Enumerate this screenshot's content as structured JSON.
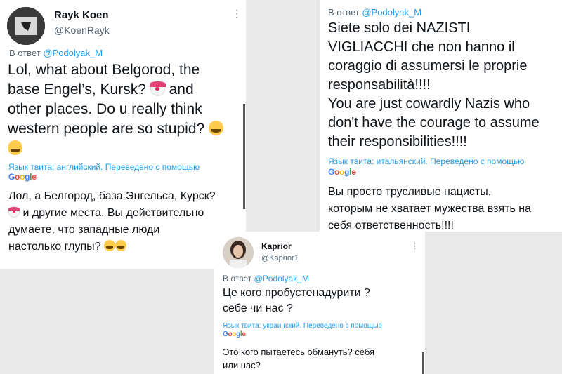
{
  "tweet1": {
    "name": "Rayk Koen",
    "handle": "@KoenRayk",
    "reply_prefix": "В ответ",
    "reply_to": "@Podolyak_M",
    "line1": "Lol, what about Belgorod, the",
    "line2a": "base Engel’s, Kursk?",
    "line2b": "and",
    "line3": "other places. Do u really think",
    "line4": "western people are so stupid?",
    "translation_meta": "Язык твита: английский. Переведено с помощью",
    "trans_line1": "Лол, а Белгород, база Энгельса, Курск?",
    "trans_line2": "и другие места. Вы действительно",
    "trans_line3": "думаете, что западные люди",
    "trans_line4": "настолько глупы?"
  },
  "tweet2": {
    "reply_prefix": "В ответ",
    "reply_to": "@Podolyak_M",
    "line1": "Siete solo dei NAZISTI",
    "line2": "VIGLIACCHI che non hanno il",
    "line3": "coraggio di assumersi le proprie",
    "line4": "responsabilità!!!!",
    "line5": "You are just cowardly Nazis who",
    "line6": "don't have the courage to assume",
    "line7": "their responsibilities!!!!",
    "translation_meta": "Язык твита: итальянский. Переведено с помощью",
    "trans_line1": "Вы просто трусливые нацисты,",
    "trans_line2": "которым не хватает мужества взять на",
    "trans_line3": "себя ответственность!!!!"
  },
  "tweet3": {
    "name": "Kaprior",
    "handle": "@Kaprior1",
    "reply_prefix": "В ответ",
    "reply_to": "@Podolyak_M",
    "line1": "Це кого пробуєтенадурити ?",
    "line2": "себе чи нас ?",
    "translation_meta": "Язык твита: украинский. Переведено с помощью",
    "trans_line1": "Это кого пытаетесь обмануть? себя",
    "trans_line2": "или нас?"
  },
  "google": [
    "G",
    "o",
    "o",
    "g",
    "l",
    "e"
  ],
  "icons": {
    "more": "more-dots-icon",
    "clown": "clown-face-icon",
    "laugh": "tears-of-joy-icon"
  }
}
